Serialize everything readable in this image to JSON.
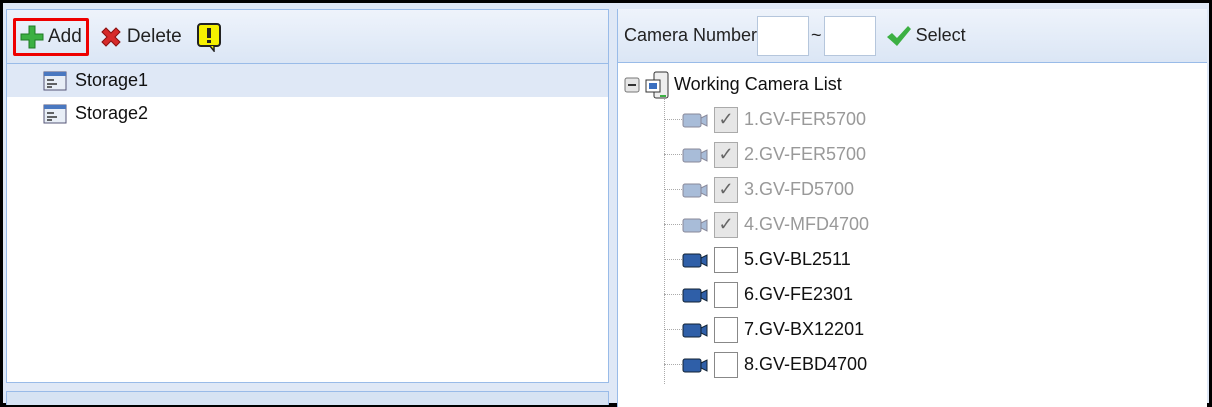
{
  "left": {
    "toolbar": {
      "add_label": "Add",
      "delete_label": "Delete"
    },
    "storages": [
      "Storage1",
      "Storage2"
    ]
  },
  "right": {
    "camera_number_label": "Camera Number",
    "range_from": "",
    "range_to": "",
    "tilde": "~",
    "select_label": "Select",
    "tree_root": "Working Camera List",
    "cameras": [
      {
        "label": "1.GV-FER5700",
        "checked": true,
        "disabled": true
      },
      {
        "label": "2.GV-FER5700",
        "checked": true,
        "disabled": true
      },
      {
        "label": "3.GV-FD5700",
        "checked": true,
        "disabled": true
      },
      {
        "label": "4.GV-MFD4700",
        "checked": true,
        "disabled": true
      },
      {
        "label": "5.GV-BL2511",
        "checked": false,
        "disabled": false
      },
      {
        "label": "6.GV-FE2301",
        "checked": false,
        "disabled": false
      },
      {
        "label": "7.GV-BX12201",
        "checked": false,
        "disabled": false
      },
      {
        "label": "8.GV-EBD4700",
        "checked": false,
        "disabled": false
      }
    ]
  }
}
